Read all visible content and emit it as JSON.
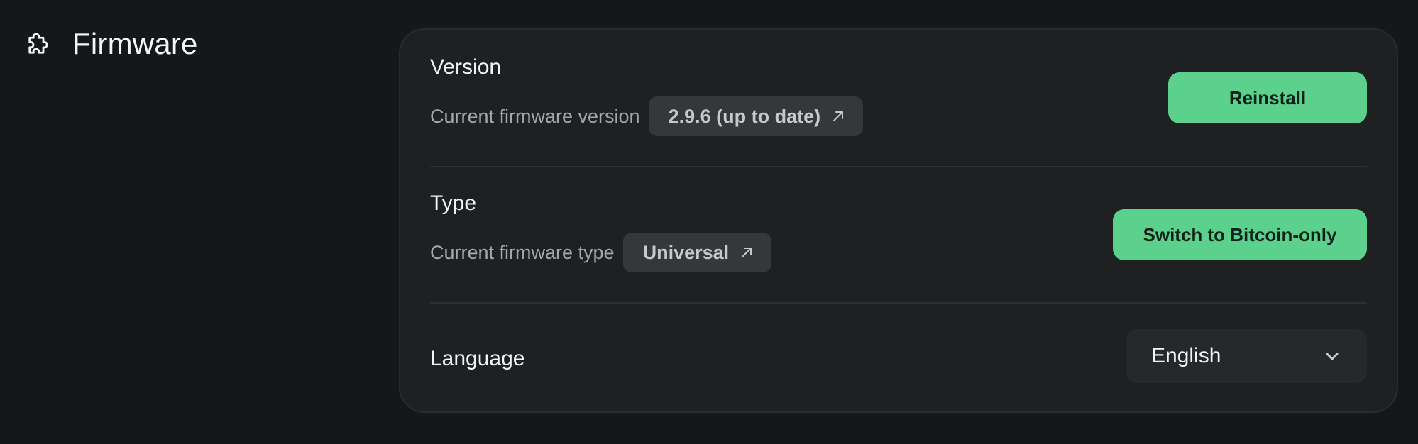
{
  "section": {
    "title": "Firmware",
    "icon": "puzzle-icon"
  },
  "version": {
    "title": "Version",
    "label": "Current firmware version",
    "value": "2.9.6 (up to date)",
    "value_icon": "external-link-icon",
    "button_label": "Reinstall"
  },
  "type": {
    "title": "Type",
    "label": "Current firmware type",
    "value": "Universal",
    "value_icon": "external-link-icon",
    "button_label": "Switch to Bitcoin-only"
  },
  "language": {
    "title": "Language",
    "selected": "English",
    "dropdown_icon": "chevron-down-icon"
  },
  "colors": {
    "background": "#161719",
    "card": "#1f2022",
    "accent": "#5cd08d",
    "pill": "#36373a"
  }
}
